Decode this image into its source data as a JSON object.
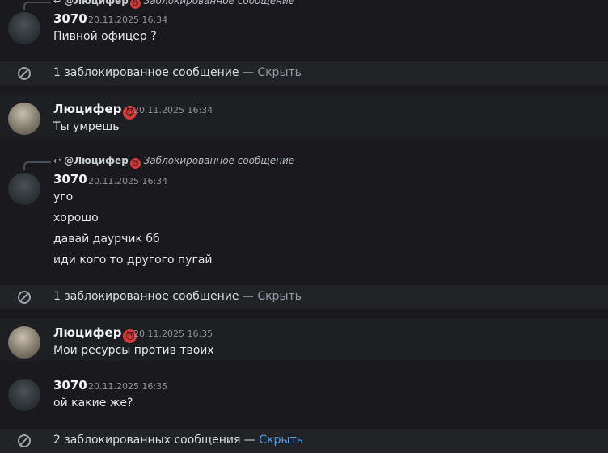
{
  "messages": {
    "m1": {
      "reply_author": "@Люцифер",
      "reply_text": "Заблокированное сообщение",
      "author": "3070",
      "time": "20.11.2025 16:34",
      "lines": [
        "Пивной офицер ?"
      ]
    },
    "b1": {
      "text": "1 заблокированное сообщение — ",
      "action": "Скрыть"
    },
    "m2": {
      "author": "Люцифер",
      "time": "20.11.2025 16:34",
      "lines": [
        "Ты умрешь"
      ]
    },
    "m3": {
      "reply_author": "@Люцифер",
      "reply_text": "Заблокированное сообщение",
      "author": "3070",
      "time": "20.11.2025 16:34",
      "lines": [
        "уго",
        "хорошо",
        "давай даурчик бб",
        "иди кого то другого пугай"
      ]
    },
    "b2": {
      "text": "1 заблокированное сообщение — ",
      "action": "Скрыть"
    },
    "m4": {
      "author": "Люцифер",
      "time": "20.11.2025 16:35",
      "lines": [
        "Мои ресурсы против твоих"
      ]
    },
    "m5": {
      "author": "3070",
      "time": "20.11.2025 16:35",
      "lines": [
        "ой какие же?"
      ]
    },
    "b3": {
      "text": "2 заблокированных сообщения — ",
      "action": "Скрыть"
    }
  },
  "icons": {
    "blocked": "block-icon",
    "reply": "reply-arrow-icon",
    "badge": "demon-emoji-icon"
  },
  "colors": {
    "background": "#1a1a1e",
    "blocked_bar": "#222327",
    "link_blue": "#4f9eea",
    "badge_red": "#d63a3a"
  }
}
